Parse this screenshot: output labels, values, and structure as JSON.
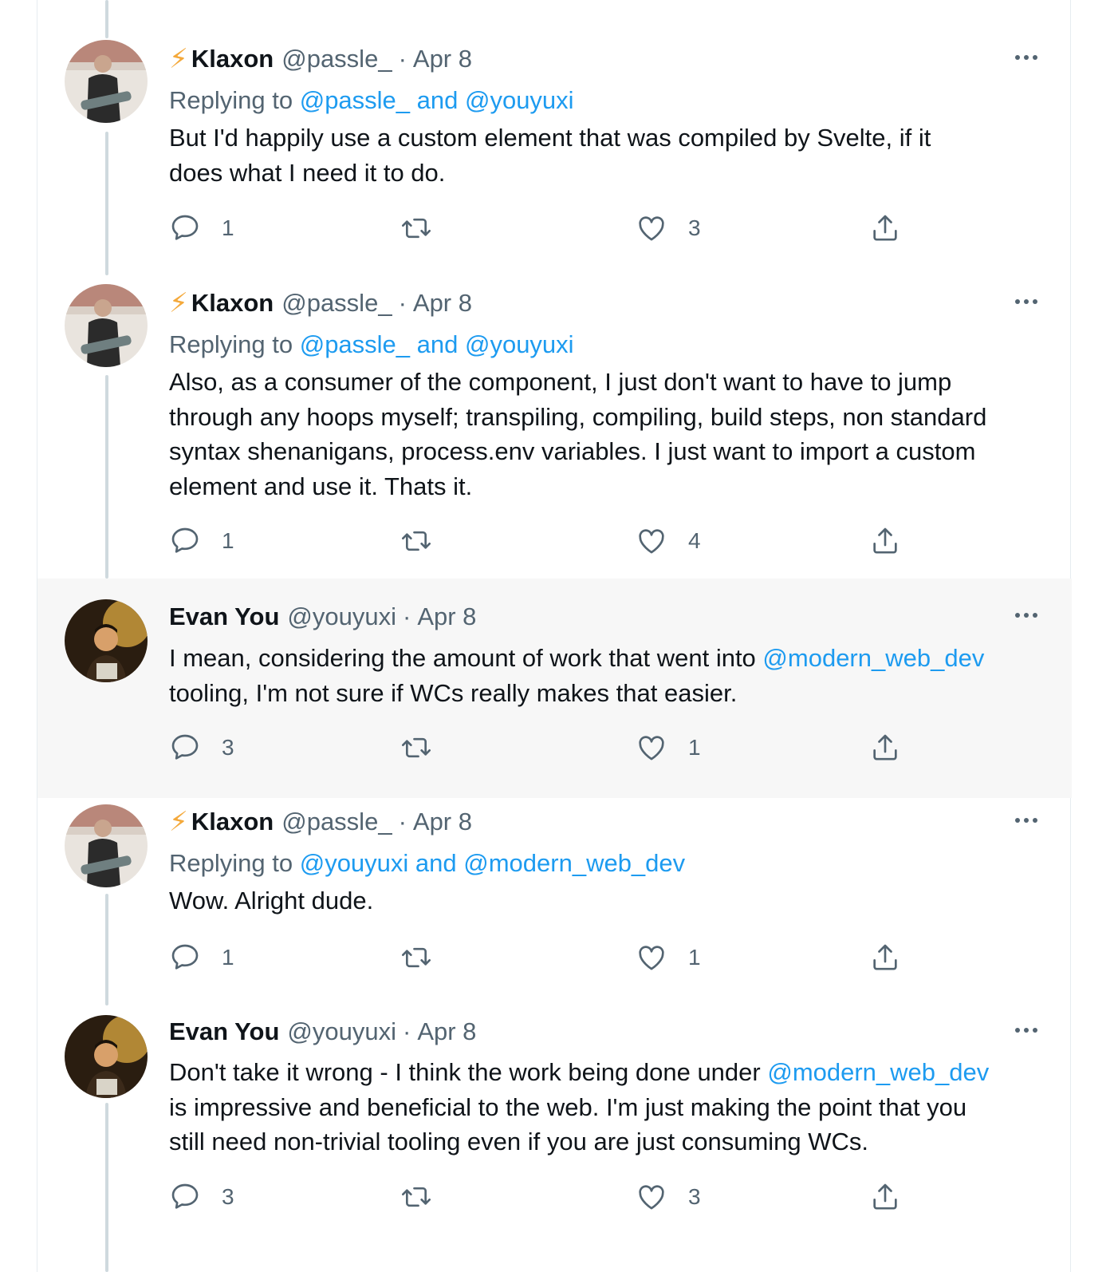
{
  "tweets": [
    {
      "display_name": "Klaxon",
      "name_prefix": "⚡",
      "handle": "@passle_",
      "separator": "·",
      "date": "Apr 8",
      "replying_prefix": "Replying to",
      "replying_links": "@passle_ and @youyuxi",
      "text_lines": [
        "But I'd happily use a custom element that was compiled by Svelte, if it",
        "does what I need it to do."
      ],
      "reply_count": "1",
      "retweet_count": "",
      "like_count": "3",
      "highlighted": false
    },
    {
      "display_name": "Klaxon",
      "name_prefix": "⚡",
      "handle": "@passle_",
      "separator": "·",
      "date": "Apr 8",
      "replying_prefix": "Replying to",
      "replying_links": "@passle_ and @youyuxi",
      "text_lines": [
        "Also, as a consumer of the component, I just don't want to have to jump",
        "through any hoops myself; transpiling, compiling, build steps, non standard",
        "syntax shenanigans, process.env variables. I just want to import a custom",
        "element and use it. Thats it."
      ],
      "reply_count": "1",
      "retweet_count": "",
      "like_count": "4",
      "highlighted": false
    },
    {
      "display_name": "Evan You",
      "handle": "@youyuxi",
      "separator": "·",
      "date": "Apr 8",
      "text_line1_before": "I mean, considering the amount of work that went into ",
      "text_line1_link": "@modern_web_dev",
      "text_line2": "tooling, I'm not sure if WCs really makes that easier.",
      "reply_count": "3",
      "retweet_count": "",
      "like_count": "1",
      "highlighted": true
    },
    {
      "display_name": "Klaxon",
      "name_prefix": "⚡",
      "handle": "@passle_",
      "separator": "·",
      "date": "Apr 8",
      "replying_prefix": "Replying to",
      "replying_links": "@youyuxi and @modern_web_dev",
      "text_lines": [
        "Wow. Alright dude."
      ],
      "reply_count": "1",
      "retweet_count": "",
      "like_count": "1",
      "highlighted": false
    },
    {
      "display_name": "Evan You",
      "handle": "@youyuxi",
      "separator": "·",
      "date": "Apr 8",
      "text_line1_before": "Don't take it wrong - I think the work being done under ",
      "text_line1_link": "@modern_web_dev",
      "text_line2": "is impressive and beneficial to the web. I'm just making the point that you",
      "text_line3": "still need non-trivial tooling even if you are just consuming WCs.",
      "reply_count": "3",
      "retweet_count": "",
      "like_count": "3",
      "highlighted": false
    }
  ],
  "colors": {
    "link": "#1d9bf0",
    "secondary_text": "#536471",
    "thread_line": "#cfd9de",
    "highlight_bg": "#f7f7f7",
    "bolt": "#f4a93b"
  },
  "icons": {
    "reply": "reply-bubble-icon",
    "retweet": "retweet-arrows-icon",
    "like": "heart-icon",
    "share": "share-upload-icon",
    "more": "more-dots-icon"
  }
}
